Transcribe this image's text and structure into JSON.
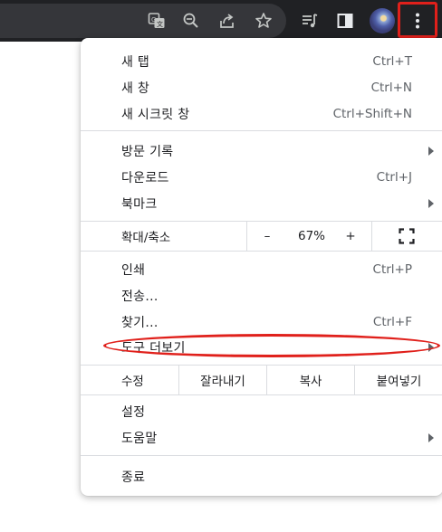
{
  "menu": {
    "new_tab": {
      "label": "새 탭",
      "shortcut": "Ctrl+T"
    },
    "new_window": {
      "label": "새 창",
      "shortcut": "Ctrl+N"
    },
    "incognito": {
      "label": "새 시크릿 창",
      "shortcut": "Ctrl+Shift+N"
    },
    "history": {
      "label": "방문 기록"
    },
    "downloads": {
      "label": "다운로드",
      "shortcut": "Ctrl+J"
    },
    "bookmarks": {
      "label": "북마크"
    },
    "zoom": {
      "label": "확대/축소",
      "minus": "–",
      "value": "67%",
      "plus": "+"
    },
    "print": {
      "label": "인쇄",
      "shortcut": "Ctrl+P"
    },
    "cast": {
      "label": "전송..."
    },
    "find": {
      "label": "찾기...",
      "shortcut": "Ctrl+F"
    },
    "more_tools": {
      "label": "도구 더보기"
    },
    "edit": {
      "label": "수정",
      "cut": "잘라내기",
      "copy": "복사",
      "paste": "붙여넣기"
    },
    "settings": {
      "label": "설정"
    },
    "help": {
      "label": "도움말"
    },
    "exit": {
      "label": "종료"
    }
  },
  "colors": {
    "highlight": "#e0201b",
    "toolbar": "#202124"
  }
}
